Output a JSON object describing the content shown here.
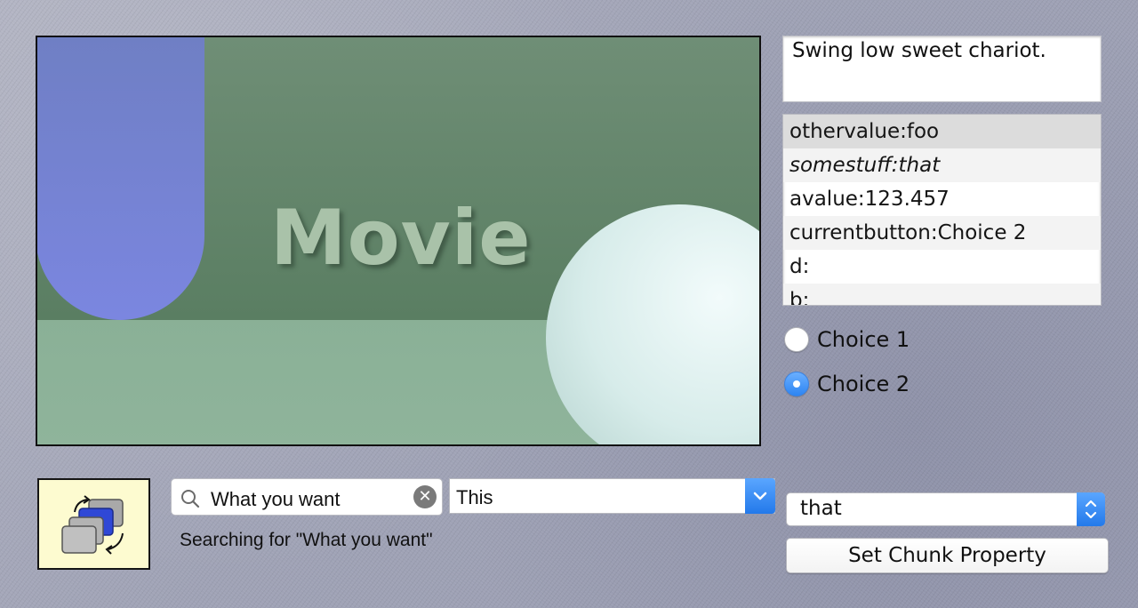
{
  "movie": {
    "title": "Movie"
  },
  "text_field": {
    "value": "Swing low sweet chariot."
  },
  "property_list": {
    "rows": [
      "othervalue:foo",
      "somestuff:that",
      "avalue:123.457",
      "currentbutton:Choice 2",
      "d:",
      "b:"
    ]
  },
  "radios": [
    {
      "label": "Choice 1",
      "selected": false
    },
    {
      "label": "Choice 2",
      "selected": true
    }
  ],
  "search": {
    "value": "What you want"
  },
  "popup_left": {
    "value": "This"
  },
  "status_text": "Searching for \"What you want\"",
  "popup_right": {
    "value": "that"
  },
  "set_button": {
    "label": "Set Chunk Property"
  },
  "colors": {
    "accent_blue": "#2d85f3",
    "icon_box_bg": "#fdfbd0"
  },
  "icons": [
    "search-icon",
    "clear-icon",
    "chevron-updown-icon",
    "chevron-down-icon",
    "transition-icon"
  ]
}
